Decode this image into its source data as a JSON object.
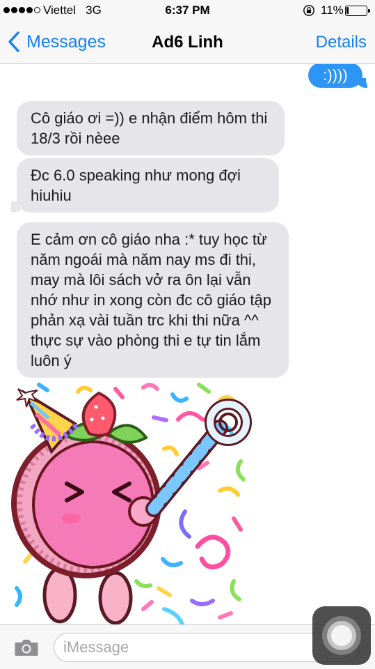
{
  "status_bar": {
    "carrier": "Viettel",
    "network": "3G",
    "time": "6:37 PM",
    "battery_percent": "11%",
    "battery_level": 0.11,
    "signal_bars": 4,
    "signal_max": 5
  },
  "nav": {
    "back_label": "Messages",
    "title": "Ad6 Linh",
    "details_label": "Details"
  },
  "messages": [
    {
      "direction": "outgoing",
      "text": ":))))"
    },
    {
      "direction": "incoming",
      "text": "Cô giáo ơi =)) e nhận điểm hôm thi 18/3 rồi nèee"
    },
    {
      "direction": "incoming",
      "text": "Đc 6.0 speaking như mong đợi hiuhiu"
    },
    {
      "direction": "incoming",
      "text": "E cảm ơn cô giáo nha :* tuy học từ năm ngoái mà năm nay ms đi thi, may mà lôi sách vở ra ôn lại vẫn nhớ như in xong còn đc cô giáo tập phản xạ vài tuần trc khi thi nữa ^^ thực sự vào phòng thi e tự tin lắm luôn ý"
    },
    {
      "direction": "incoming",
      "type": "sticker",
      "sticker": "celebrating-peach-character"
    }
  ],
  "input": {
    "placeholder": "iMessage"
  },
  "icons": {
    "back": "chevron-left-icon",
    "camera": "camera-icon",
    "lock": "rotation-lock-icon",
    "assistive": "assistive-touch-icon"
  },
  "colors": {
    "accent": "#157efb",
    "outgoing_bubble": "#2c95f6",
    "incoming_bubble": "#e5e5ea",
    "bar_background": "#f7f7f7"
  }
}
